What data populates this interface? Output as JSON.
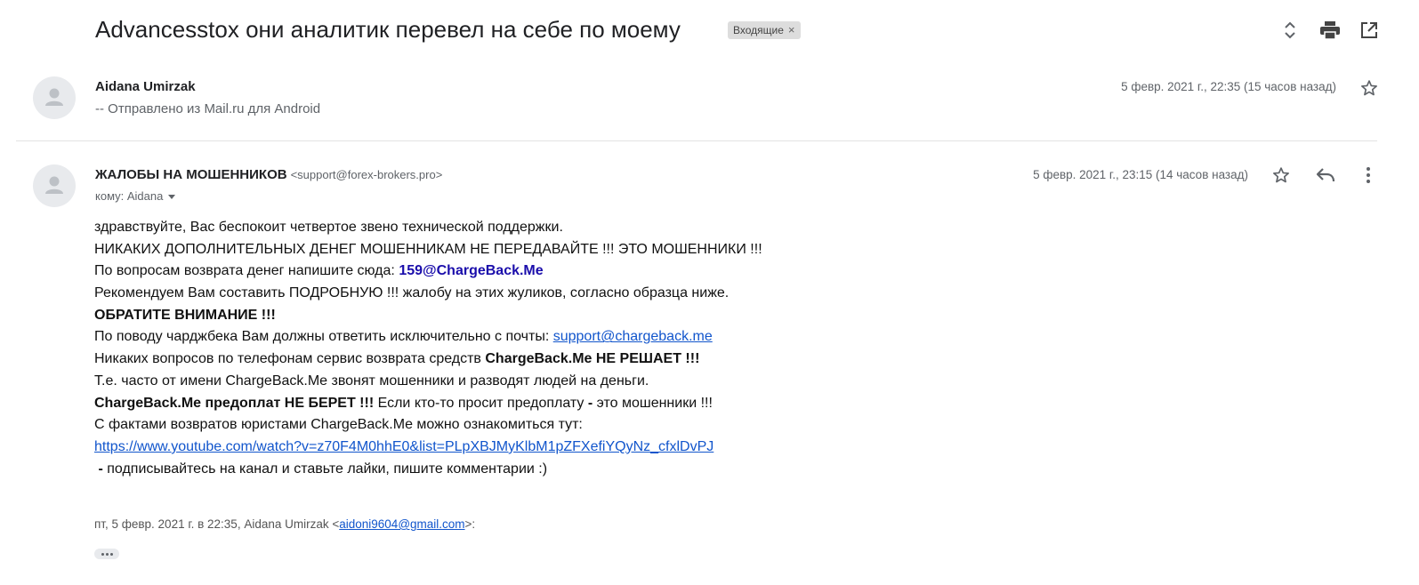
{
  "header": {
    "subject": "Advancesstox они аналитик перевел на себе по моему",
    "label": "Входящие",
    "label_remove": "×"
  },
  "messages": [
    {
      "sender": "Aidana Umirzak",
      "snippet": "-- Отправлено из Mail.ru для Android",
      "date": "5 февр. 2021 г., 22:35 (15 часов назад)"
    },
    {
      "sender": "ЖАЛОБЫ НА МОШЕННИКОВ",
      "sender_email": "<support@forex-brokers.pro>",
      "to": "кому: Aidana",
      "date": "5 февр. 2021 г., 23:15 (14 часов назад)"
    }
  ],
  "body": {
    "l1": "здравствуйте, Вас беспокоит четвертое звено технической поддержки.",
    "l2": "НИКАКИХ ДОПОЛНИТЕЛЬНЫХ ДЕНЕГ МОШЕННИКАМ НЕ ПЕРЕДАВАЙТЕ !!! ЭТО МОШЕННИКИ !!!",
    "l3_prefix": "По вопросам возврата денег напишите сюда: ",
    "l3_email": "159@ChargeBack.Me",
    "l4": "Рекомендуем Вам составить ПОДРОБНУЮ !!! жалобу на этих жуликов, согласно образца ниже.",
    "l5": "ОБРАТИТЕ ВНИМАНИЕ !!!",
    "l6_prefix": "По поводу чарджбека Вам должны ответить исключительно с почты: ",
    "l6_link": "support@chargeback.me",
    "l7_prefix": "Никаких вопросов по телефонам сервис возврата средств ",
    "l7_bold": "ChargeBack.Me НЕ РЕШАЕТ !!!",
    "l8": "Т.е. часто от имени ChargeBack.Me звонят мошенники и разводят людей на деньги.",
    "l9_bold": "ChargeBack.Me предоплат НЕ БЕРЕТ !!!",
    "l9_mid": " Если кто-то просит предоплату ",
    "l9_dash": "-",
    "l9_end": " это мошенники !!!",
    "l10": "С фактами возвратов юристами ChargeBack.Me можно ознакомиться тут:",
    "l11_link": "https://www.youtube.com/watch?v=z70F4M0hhE0&list=PLpXBJMyKlbM1pZFXefiYQyNz_cfxlDvPJ",
    "l12_dash": "-",
    "l12_rest": " подписывайтесь на канал и ставьте лайки, пишите комментарии :)"
  },
  "quote": {
    "prefix": "пт, 5 февр. 2021 г. в 22:35, Aidana Umirzak <",
    "email": "aidoni9604@gmail.com",
    "suffix": ">:"
  },
  "colors": {
    "link": "#1155cc",
    "bold_email": "#1a0dab",
    "muted": "#5f6368"
  },
  "icons": [
    "expand-all-icon",
    "print-icon",
    "open-in-new-window-icon",
    "star-icon",
    "reply-icon",
    "more-vert-icon",
    "ellipsis-icon"
  ]
}
